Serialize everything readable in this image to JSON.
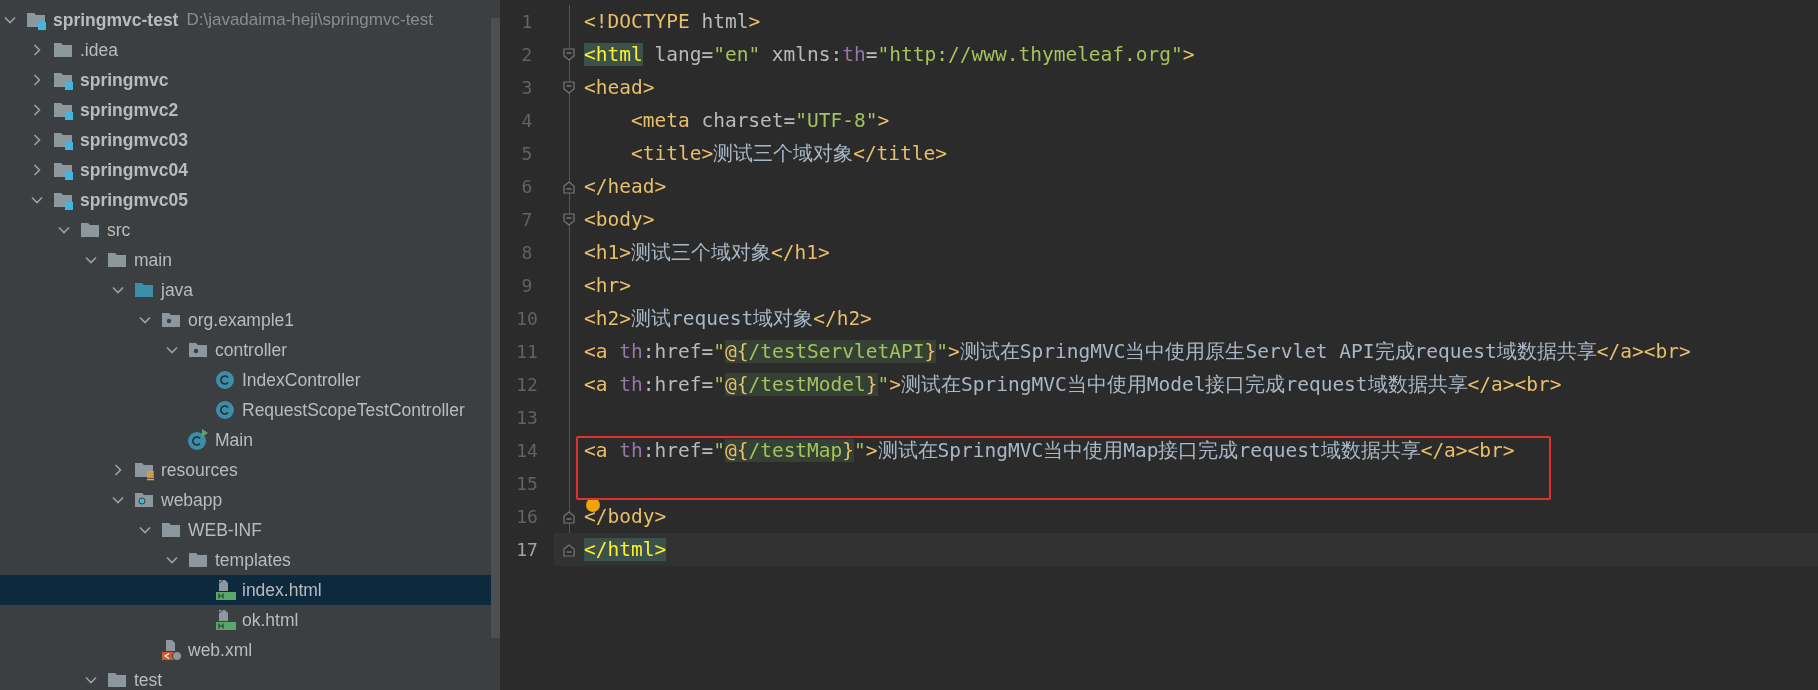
{
  "project_tree": {
    "items": [
      {
        "label": "springmvc-test",
        "location": "D:\\javadaima-heji\\springmvc-test",
        "kind": "module",
        "expanded": true,
        "selected": false,
        "children": [
          {
            "label": ".idea",
            "kind": "folder",
            "expanded": false,
            "selected": false
          },
          {
            "label": "springmvc",
            "kind": "module",
            "expanded": false,
            "selected": false
          },
          {
            "label": "springmvc2",
            "kind": "module",
            "expanded": false,
            "selected": false
          },
          {
            "label": "springmvc03",
            "kind": "module",
            "expanded": false,
            "selected": false
          },
          {
            "label": "springmvc04",
            "kind": "module",
            "expanded": false,
            "selected": false
          },
          {
            "label": "springmvc05",
            "kind": "module",
            "expanded": true,
            "selected": false,
            "children": [
              {
                "label": "src",
                "kind": "folder",
                "expanded": true,
                "selected": false,
                "children": [
                  {
                    "label": "main",
                    "kind": "folder",
                    "expanded": true,
                    "selected": false,
                    "children": [
                      {
                        "label": "java",
                        "kind": "sources",
                        "expanded": true,
                        "selected": false,
                        "children": [
                          {
                            "label": "org.example1",
                            "kind": "package",
                            "expanded": true,
                            "selected": false,
                            "children": [
                              {
                                "label": "controller",
                                "kind": "package",
                                "expanded": true,
                                "selected": false,
                                "children": [
                                  {
                                    "label": "IndexController",
                                    "kind": "class",
                                    "selected": false
                                  },
                                  {
                                    "label": "RequestScopeTestController",
                                    "kind": "class",
                                    "selected": false
                                  }
                                ]
                              },
                              {
                                "label": "Main",
                                "kind": "runnable",
                                "selected": false
                              }
                            ]
                          }
                        ]
                      },
                      {
                        "label": "resources",
                        "kind": "resources",
                        "expanded": false,
                        "selected": false
                      },
                      {
                        "label": "webapp",
                        "kind": "web",
                        "expanded": true,
                        "selected": false,
                        "children": [
                          {
                            "label": "WEB-INF",
                            "kind": "folder",
                            "expanded": true,
                            "selected": false,
                            "children": [
                              {
                                "label": "templates",
                                "kind": "folder",
                                "expanded": true,
                                "selected": false,
                                "children": [
                                  {
                                    "label": "index.html",
                                    "kind": "html",
                                    "selected": true
                                  },
                                  {
                                    "label": "ok.html",
                                    "kind": "html",
                                    "selected": false
                                  }
                                ]
                              }
                            ]
                          },
                          {
                            "label": "web.xml",
                            "kind": "xml",
                            "selected": false
                          }
                        ]
                      }
                    ]
                  },
                  {
                    "label": "test",
                    "kind": "folder",
                    "expanded": true,
                    "selected": false
                  }
                ]
              }
            ]
          }
        ]
      }
    ]
  },
  "editor": {
    "lines": [
      {
        "number": "1",
        "kind": "plain",
        "tokens": [
          {
            "kind": "tag",
            "s": "<!DOCTYPE"
          },
          {
            "kind": "attr",
            "s": " html"
          },
          {
            "kind": "tag",
            "s": ">"
          }
        ]
      },
      {
        "number": "2",
        "kind": "fold-start",
        "tokens": [
          {
            "kind": "tag",
            "s": "<html",
            "matched": true
          },
          {
            "kind": "attr",
            "s": " lang="
          },
          {
            "kind": "str",
            "s": "\"en\""
          },
          {
            "kind": "attr",
            "s": " xmlns:"
          },
          {
            "kind": "ns",
            "s": "th"
          },
          {
            "kind": "attr",
            "s": "="
          },
          {
            "kind": "str",
            "s": "\"http://www.thymeleaf.org\""
          },
          {
            "kind": "tag",
            "s": ">"
          }
        ]
      },
      {
        "number": "3",
        "kind": "fold-start",
        "tokens": [
          {
            "kind": "tag",
            "s": "<head>"
          }
        ]
      },
      {
        "number": "4",
        "kind": "plain",
        "tokens": [
          {
            "kind": "tag",
            "s": "    <meta"
          },
          {
            "kind": "attr",
            "s": " charset="
          },
          {
            "kind": "str",
            "s": "\"UTF-8\""
          },
          {
            "kind": "tag",
            "s": ">"
          }
        ]
      },
      {
        "number": "5",
        "kind": "plain",
        "tokens": [
          {
            "kind": "tag",
            "s": "    <title>"
          },
          {
            "kind": "text",
            "s": "测试三个域对象"
          },
          {
            "kind": "tag",
            "s": "</title>"
          }
        ]
      },
      {
        "number": "6",
        "kind": "fold-end",
        "tokens": [
          {
            "kind": "tag",
            "s": "</head>"
          }
        ]
      },
      {
        "number": "7",
        "kind": "fold-start",
        "tokens": [
          {
            "kind": "tag",
            "s": "<body>"
          }
        ]
      },
      {
        "number": "8",
        "kind": "plain",
        "tokens": [
          {
            "kind": "tag",
            "s": "<h1>"
          },
          {
            "kind": "text",
            "s": "测试三个域对象"
          },
          {
            "kind": "tag",
            "s": "</h1>"
          }
        ]
      },
      {
        "number": "9",
        "kind": "plain",
        "tokens": [
          {
            "kind": "tag",
            "s": "<hr>"
          }
        ]
      },
      {
        "number": "10",
        "kind": "plain",
        "tokens": [
          {
            "kind": "tag",
            "s": "<h2>"
          },
          {
            "kind": "text",
            "s": "测试request域对象"
          },
          {
            "kind": "tag",
            "s": "</h2>"
          }
        ]
      },
      {
        "number": "11",
        "kind": "plain",
        "tokens": [
          {
            "kind": "tag",
            "s": "<a"
          },
          {
            "kind": "ns",
            "s": " th"
          },
          {
            "kind": "attr",
            "s": ":href="
          },
          {
            "kind": "str",
            "s": "\""
          },
          {
            "kind": "brace",
            "s": "@{"
          },
          {
            "kind": "expr",
            "s": "/testServletAPI"
          },
          {
            "kind": "brace",
            "s": "}"
          },
          {
            "kind": "str",
            "s": "\""
          },
          {
            "kind": "tag",
            "s": ">"
          },
          {
            "kind": "text",
            "s": "测试在SpringMVC当中使用原生Servlet API完成request域数据共享"
          },
          {
            "kind": "tag",
            "s": "</a><br>"
          }
        ]
      },
      {
        "number": "12",
        "kind": "plain",
        "tokens": [
          {
            "kind": "tag",
            "s": "<a"
          },
          {
            "kind": "ns",
            "s": " th"
          },
          {
            "kind": "attr",
            "s": ":href="
          },
          {
            "kind": "str",
            "s": "\""
          },
          {
            "kind": "brace",
            "s": "@{"
          },
          {
            "kind": "expr",
            "s": "/testModel"
          },
          {
            "kind": "brace",
            "s": "}"
          },
          {
            "kind": "str",
            "s": "\""
          },
          {
            "kind": "tag",
            "s": ">"
          },
          {
            "kind": "text",
            "s": "测试在SpringMVC当中使用Model接口完成request域数据共享"
          },
          {
            "kind": "tag",
            "s": "</a><br>"
          }
        ]
      },
      {
        "number": "13",
        "kind": "plain"
      },
      {
        "number": "14",
        "kind": "plain",
        "boxed": true,
        "tokens": [
          {
            "kind": "tag",
            "s": "<a"
          },
          {
            "kind": "ns",
            "s": " th"
          },
          {
            "kind": "attr",
            "s": ":href="
          },
          {
            "kind": "str",
            "s": "\""
          },
          {
            "kind": "brace",
            "s": "@{"
          },
          {
            "kind": "expr",
            "s": "/testMap"
          },
          {
            "kind": "brace",
            "s": "}"
          },
          {
            "kind": "str",
            "s": "\""
          },
          {
            "kind": "tag",
            "s": ">"
          },
          {
            "kind": "text",
            "s": "测试在SpringMVC当中使用Map接口完成request域数据共享"
          },
          {
            "kind": "tag",
            "s": "</a><br>"
          }
        ]
      },
      {
        "number": "15",
        "kind": "plain",
        "boxed": true
      },
      {
        "number": "16",
        "kind": "fold-end",
        "bulb": true,
        "tokens": [
          {
            "kind": "tag",
            "s": "</body>"
          }
        ]
      },
      {
        "number": "17",
        "kind": "fold-end",
        "current": true,
        "tokens": [
          {
            "kind": "tag",
            "s": "</html>",
            "matched": true
          }
        ]
      }
    ]
  }
}
